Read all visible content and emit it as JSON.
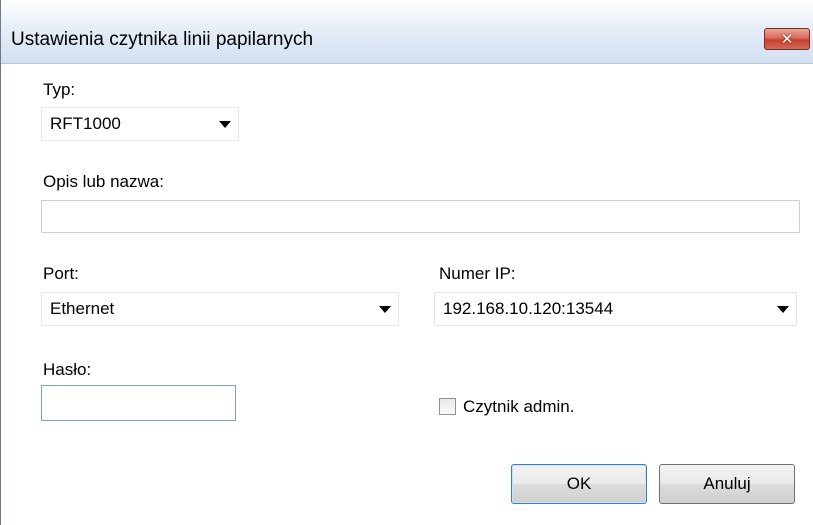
{
  "window": {
    "title": "Ustawienia czytnika linii papilarnych",
    "close_glyph": "✕"
  },
  "form": {
    "type_label": "Typ:",
    "type_value": "RFT1000",
    "description_label": "Opis lub nazwa:",
    "description_value": "",
    "port_label": "Port:",
    "port_value": "Ethernet",
    "ip_label": "Numer IP:",
    "ip_value": "192.168.10.120:13544",
    "password_label": "Hasło:",
    "password_value": "",
    "admin_checkbox_label": "Czytnik admin.",
    "admin_checked": false
  },
  "buttons": {
    "ok_label": "OK",
    "cancel_label": "Anuluj"
  }
}
